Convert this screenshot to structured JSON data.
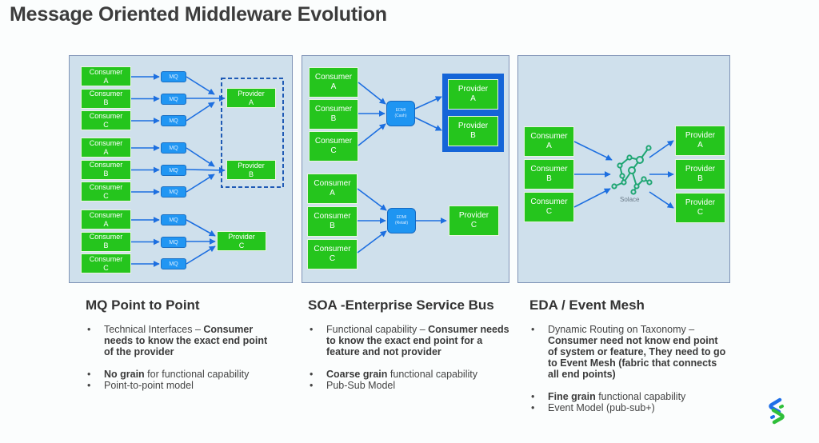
{
  "title": "Message Oriented Middleware Evolution",
  "panels": {
    "mq": {
      "groups": [
        {
          "consumers": [
            "Consumer A",
            "Consumer B",
            "Consumer C"
          ],
          "queue_label": "MQ",
          "provider": "Provider A"
        },
        {
          "consumers": [
            "Consumer A",
            "Consumer B",
            "Consumer C"
          ],
          "queue_label": "MQ",
          "provider": "Provider B"
        },
        {
          "consumers": [
            "Consumer A",
            "Consumer B",
            "Consumer C"
          ],
          "queue_label": "MQ",
          "provider": "Provider C"
        }
      ]
    },
    "soa": {
      "groups": [
        {
          "consumers": [
            "Consumer A",
            "Consumer B",
            "Consumer C"
          ],
          "bus_label": [
            "EDMI",
            "(Cash)"
          ],
          "providers": [
            "Provider A",
            "Provider B"
          ]
        },
        {
          "consumers": [
            "Consumer A",
            "Consumer B",
            "Consumer C"
          ],
          "bus_label": [
            "EDMI",
            "(Retail)"
          ],
          "providers": [
            "Provider C"
          ]
        }
      ]
    },
    "eda": {
      "consumers": [
        "Consumer A",
        "Consumer B",
        "Consumer C"
      ],
      "broker_label": "Solace",
      "providers": [
        "Provider A",
        "Provider B",
        "Provider C"
      ]
    }
  },
  "columns": [
    {
      "heading": "MQ Point to Point",
      "bullets": [
        {
          "normal": "Technical Interfaces – ",
          "bold": "Consumer needs to know the exact end point of the provider",
          "after": ""
        },
        {
          "normal": "",
          "bold": "No grain",
          "after": " for functional capability"
        },
        {
          "normal": "Point-to-point model",
          "bold": "",
          "after": ""
        }
      ]
    },
    {
      "heading": "SOA -Enterprise Service Bus",
      "bullets": [
        {
          "normal": "Functional capability – ",
          "bold": "Consumer needs to know the exact end point for a feature and not provider",
          "after": ""
        },
        {
          "normal": "",
          "bold": "Coarse grain",
          "after": " functional capability"
        },
        {
          "normal": "Pub-Sub Model",
          "bold": "",
          "after": ""
        }
      ]
    },
    {
      "heading": "EDA / Event Mesh",
      "bullets": [
        {
          "normal": "Dynamic Routing on Taxonomy – ",
          "bold": "Consumer need not know end point of system or feature, They need to go to Event Mesh (fabric that connects all end points)",
          "after": ""
        },
        {
          "normal": "",
          "bold": "Fine grain",
          "after": " functional capability"
        },
        {
          "normal": "Event Model (pub-sub+)",
          "bold": "",
          "after": ""
        }
      ]
    }
  ],
  "colors": {
    "component_green": "#25c51d",
    "queue_blue": "#2196f3",
    "panel_bg": "#cfe0ec",
    "arrow_blue": "#1d6fe0"
  },
  "logo": "bank-logo-icon"
}
